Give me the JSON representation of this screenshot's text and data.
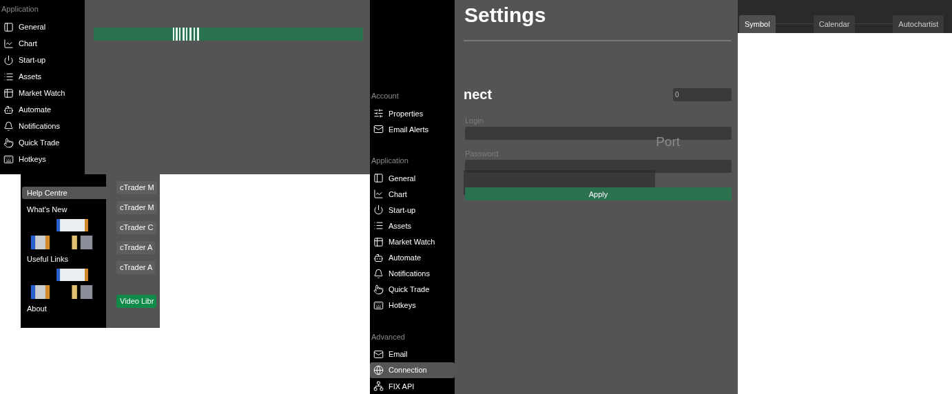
{
  "app_sidebar": {
    "section": "Application",
    "items": [
      {
        "label": "General",
        "selected": false
      },
      {
        "label": "Chart",
        "selected": false
      },
      {
        "label": "Start-up",
        "selected": false
      },
      {
        "label": "Assets",
        "selected": false
      },
      {
        "label": "Market Watch",
        "selected": false
      },
      {
        "label": "Automate",
        "selected": false
      },
      {
        "label": "Notifications",
        "selected": false
      },
      {
        "label": "Quick Trade",
        "selected": false
      },
      {
        "label": "Hotkeys",
        "selected": false
      }
    ]
  },
  "help_menu": {
    "items": [
      {
        "label": "Help Centre",
        "selected": true,
        "kind": "item"
      },
      {
        "label": "What's New",
        "selected": false,
        "kind": "item"
      },
      {
        "kind": "picture"
      },
      {
        "label": "Useful Links",
        "selected": false,
        "kind": "item"
      },
      {
        "kind": "picture"
      },
      {
        "label": "About",
        "selected": false,
        "kind": "item"
      }
    ]
  },
  "help_links": [
    {
      "label": "cTrader M",
      "kind": "link"
    },
    {
      "label": "cTrader M",
      "kind": "link"
    },
    {
      "label": "cTrader C",
      "kind": "link"
    },
    {
      "label": "cTrader A",
      "kind": "link"
    },
    {
      "label": "cTrader A",
      "kind": "link"
    },
    {
      "label": "Video Libr",
      "kind": "primary"
    }
  ],
  "settings_sidebar": {
    "sections": [
      {
        "title": "Account",
        "items": [
          {
            "label": "Properties",
            "selected": false
          },
          {
            "label": "Email Alerts",
            "selected": false
          }
        ]
      },
      {
        "title": "Application",
        "items": [
          {
            "label": "General",
            "selected": false
          },
          {
            "label": "Chart",
            "selected": false
          },
          {
            "label": "Start-up",
            "selected": false
          },
          {
            "label": "Assets",
            "selected": false
          },
          {
            "label": "Market Watch",
            "selected": false
          },
          {
            "label": "Automate",
            "selected": false
          },
          {
            "label": "Notifications",
            "selected": false
          },
          {
            "label": "Quick Trade",
            "selected": false
          },
          {
            "label": "Hotkeys",
            "selected": false
          }
        ]
      },
      {
        "title": "Advanced",
        "items": [
          {
            "label": "Email",
            "selected": false
          },
          {
            "label": "Connection",
            "selected": true
          },
          {
            "label": "FIX API",
            "selected": false
          }
        ]
      }
    ]
  },
  "connection_form": {
    "title": "Settings",
    "heading": "nect",
    "port_value": "0",
    "port_label": "Port",
    "fields": [
      {
        "label": "Login"
      },
      {
        "label": "Password"
      }
    ],
    "apply": "Apply"
  },
  "top_tabs": [
    {
      "label": "Symbol",
      "selected": true
    },
    {
      "label": "Calendar",
      "selected": false
    },
    {
      "label": "Autochartist",
      "selected": false
    }
  ]
}
